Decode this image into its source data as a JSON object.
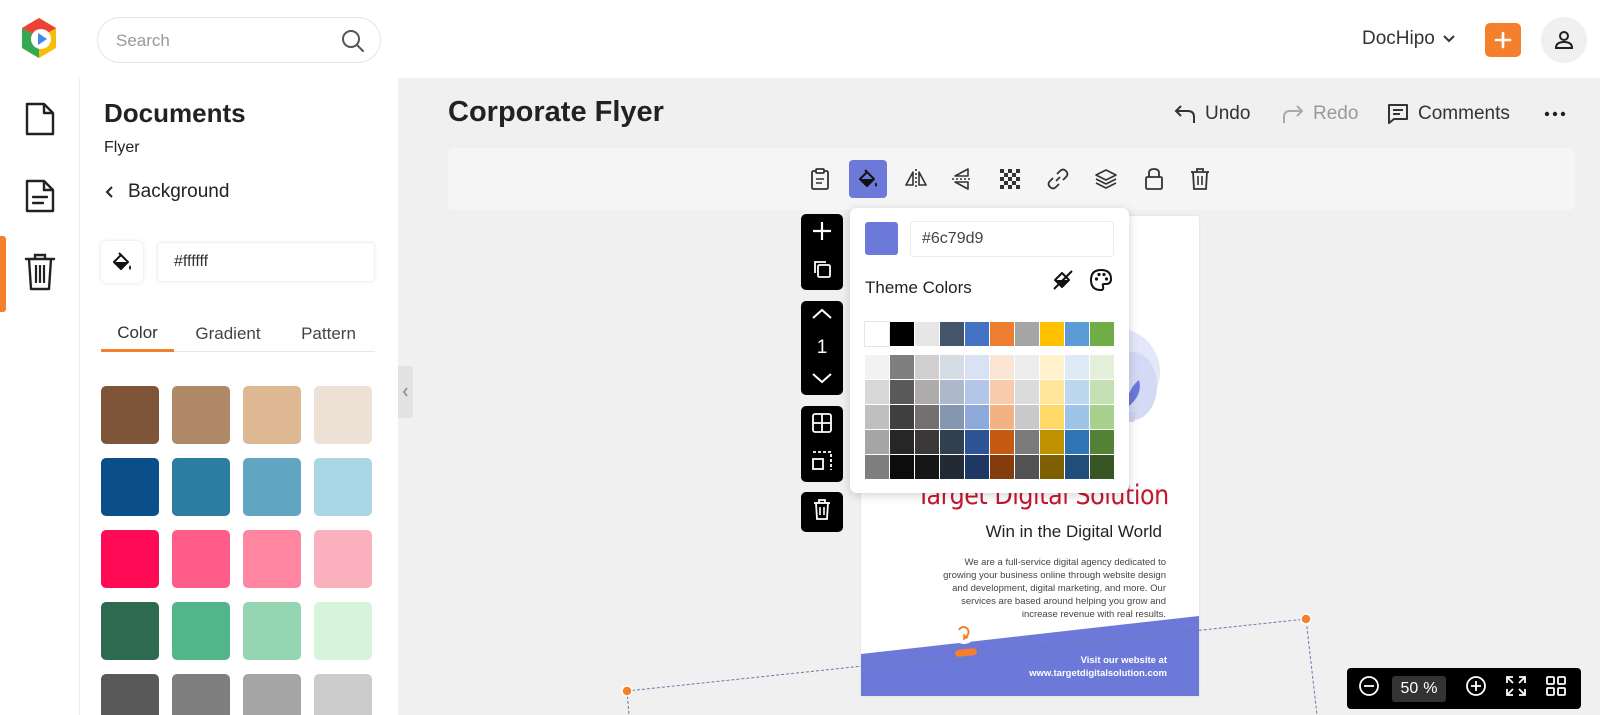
{
  "header": {
    "search_placeholder": "Search",
    "account_label": "DocHipo",
    "colors": {
      "accent": "#f47f2c"
    }
  },
  "rail": {
    "items": [
      {
        "icon": "document-icon"
      },
      {
        "icon": "template-document-icon",
        "active": true
      },
      {
        "icon": "trash-icon"
      }
    ]
  },
  "panel": {
    "title": "Documents",
    "subtitle": "Flyer",
    "back_label": "Background",
    "hex_value": "#ffffff",
    "tabs": [
      "Color",
      "Gradient",
      "Pattern"
    ],
    "active_tab": "Color",
    "swatches": [
      "#7f5539",
      "#b08968",
      "#ddb892",
      "#ede0d4",
      "#0b4f8a",
      "#2c7da0",
      "#61a5c2",
      "#a9d6e5",
      "#ff0a54",
      "#ff5c8a",
      "#ff85a1",
      "#fbb1bd",
      "#2d6a4f",
      "#52b788",
      "#95d5b2",
      "#d8f3dc",
      "#595959",
      "#7f7f7f",
      "#a5a5a5",
      "#cccccc"
    ]
  },
  "main": {
    "doc_title": "Corporate Flyer",
    "undo_label": "Undo",
    "redo_label": "Redo",
    "comments_label": "Comments",
    "page_number": "1",
    "zoom_value": "50",
    "zoom_unit": "%"
  },
  "flyer": {
    "heading": "Target Digital Solution",
    "subheading": "Win in the Digital World",
    "body": "We are a full-service digital agency dedicated to growing your business online through website design and development, digital marketing, and more. Our services are based around helping you grow and increase revenue with real results.",
    "cta_line1": "Visit our website at",
    "cta_line2": "www.targetdigitalsolution.com",
    "band_color": "#6c79d9"
  },
  "color_picker": {
    "current_hex": "#6c79d9",
    "theme_label": "Theme Colors",
    "theme_row": [
      "#ffffff",
      "#000000",
      "#e7e6e6",
      "#44546a",
      "#4472c4",
      "#ed7d31",
      "#a5a5a5",
      "#ffc000",
      "#5b9bd5",
      "#70ad47"
    ],
    "shades": [
      [
        "#f2f2f2",
        "#7f7f7f",
        "#d0cece",
        "#d6dce4",
        "#d9e2f3",
        "#fbe5d5",
        "#ededed",
        "#fff2cc",
        "#deebf6",
        "#e2efd9"
      ],
      [
        "#d8d8d8",
        "#595959",
        "#aeabab",
        "#adb9ca",
        "#b4c6e7",
        "#f7cbac",
        "#dbdbdb",
        "#fee599",
        "#bdd7ee",
        "#c5e0b3"
      ],
      [
        "#bfbfbf",
        "#3f3f3f",
        "#757070",
        "#8496b0",
        "#8eaadb",
        "#f4b183",
        "#c9c9c9",
        "#ffd965",
        "#9dc3e6",
        "#a8d08d"
      ],
      [
        "#a5a5a5",
        "#262626",
        "#3a3838",
        "#323f4f",
        "#2f5496",
        "#c55a11",
        "#7b7b7b",
        "#bf9000",
        "#2e75b5",
        "#538135"
      ],
      [
        "#7f7f7f",
        "#0c0c0c",
        "#171616",
        "#222a35",
        "#1f3864",
        "#843c0c",
        "#525252",
        "#7f6000",
        "#1e4e79",
        "#375623"
      ]
    ]
  }
}
